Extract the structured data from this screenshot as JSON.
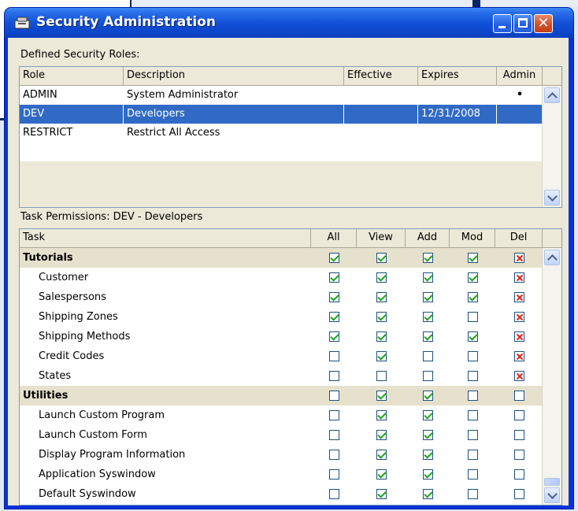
{
  "window": {
    "title": "Security Administration",
    "title_icon": "security-key-icon",
    "close_glyph": "✕"
  },
  "roles_section": {
    "label": "Defined Security Roles:",
    "columns": [
      "Role",
      "Description",
      "Effective",
      "Expires",
      "Admin"
    ],
    "rows": [
      {
        "role": "ADMIN",
        "description": "System Administrator",
        "effective": "",
        "expires": "",
        "admin": "•",
        "selected": false
      },
      {
        "role": "DEV",
        "description": "Developers",
        "effective": "",
        "expires": "12/31/2008",
        "admin": "",
        "selected": true
      },
      {
        "role": "RESTRICT",
        "description": "Restrict All Access",
        "effective": "",
        "expires": "",
        "admin": "",
        "selected": false
      }
    ]
  },
  "task_section": {
    "label": "Task Permissions: DEV - Developers",
    "columns": [
      "Task",
      "All",
      "View",
      "Add",
      "Mod",
      "Del"
    ],
    "rows": [
      {
        "task": "Tutorials",
        "group": true,
        "all": "on",
        "view": "on",
        "add": "on",
        "mod": "on",
        "del": "x"
      },
      {
        "task": "Customer",
        "group": false,
        "all": "on",
        "view": "on",
        "add": "on",
        "mod": "on",
        "del": "x"
      },
      {
        "task": "Salespersons",
        "group": false,
        "all": "on",
        "view": "on",
        "add": "on",
        "mod": "on",
        "del": "x"
      },
      {
        "task": "Shipping Zones",
        "group": false,
        "all": "on",
        "view": "on",
        "add": "on",
        "mod": "off",
        "del": "x"
      },
      {
        "task": "Shipping Methods",
        "group": false,
        "all": "on",
        "view": "on",
        "add": "on",
        "mod": "on",
        "del": "x"
      },
      {
        "task": "Credit Codes",
        "group": false,
        "all": "off",
        "view": "on",
        "add": "off",
        "mod": "off",
        "del": "x"
      },
      {
        "task": "States",
        "group": false,
        "all": "off",
        "view": "off",
        "add": "off",
        "mod": "off",
        "del": "x"
      },
      {
        "task": "Utilities",
        "group": true,
        "all": "off",
        "view": "on",
        "add": "on",
        "mod": "off",
        "del": "off"
      },
      {
        "task": "Launch Custom Program",
        "group": false,
        "all": "off",
        "view": "on",
        "add": "on",
        "mod": "off",
        "del": "off"
      },
      {
        "task": "Launch Custom Form",
        "group": false,
        "all": "off",
        "view": "on",
        "add": "on",
        "mod": "off",
        "del": "off"
      },
      {
        "task": "Display Program Information",
        "group": false,
        "all": "off",
        "view": "on",
        "add": "on",
        "mod": "off",
        "del": "off"
      },
      {
        "task": "Application Syswindow",
        "group": false,
        "all": "off",
        "view": "on",
        "add": "on",
        "mod": "off",
        "del": "off"
      },
      {
        "task": "Default Syswindow",
        "group": false,
        "all": "off",
        "view": "on",
        "add": "on",
        "mod": "off",
        "del": "off"
      }
    ]
  },
  "colors": {
    "selection": "#316ac5",
    "check": "#21a121",
    "deny": "#e0201b",
    "group_row": "#e6e1cc"
  }
}
